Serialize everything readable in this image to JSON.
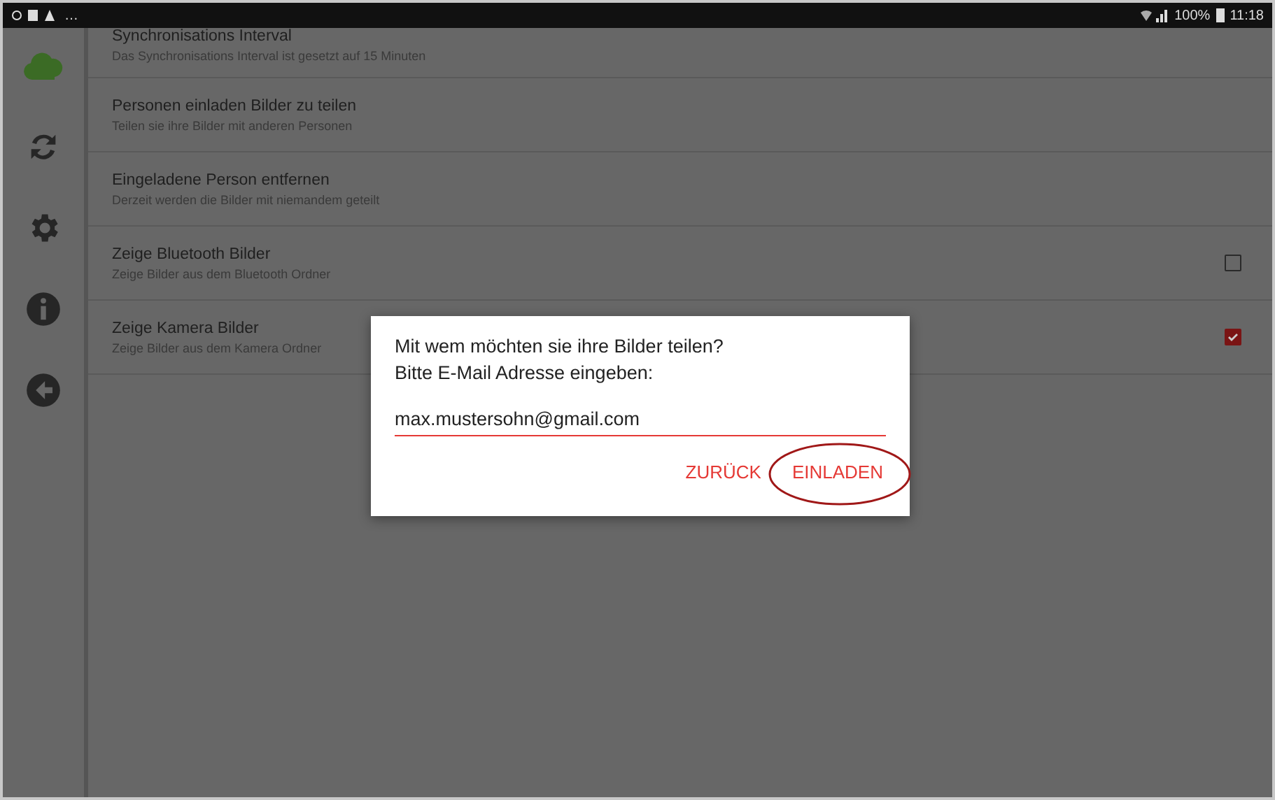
{
  "status_bar": {
    "left_text": "…",
    "battery": "100%",
    "time": "11:18"
  },
  "sidebar": {
    "items": [
      {
        "kind": "cloud",
        "selected": true
      },
      {
        "kind": "sync",
        "selected": false
      },
      {
        "kind": "settings",
        "selected": false
      },
      {
        "kind": "info",
        "selected": false
      },
      {
        "kind": "back",
        "selected": false
      }
    ]
  },
  "settings": [
    {
      "kind": "plain",
      "title": "Synchronisations Interval",
      "subtitle": "Das Synchronisations Interval ist gesetzt auf 15 Minuten"
    },
    {
      "kind": "plain",
      "title": "Personen einladen Bilder zu teilen",
      "subtitle": "Teilen sie ihre Bilder mit anderen Personen"
    },
    {
      "kind": "plain",
      "title": "Eingeladene Person entfernen",
      "subtitle": "Derzeit werden die Bilder mit niemandem geteilt"
    },
    {
      "kind": "checkbox",
      "title": "Zeige Bluetooth Bilder",
      "subtitle": "Zeige Bilder aus dem Bluetooth Ordner",
      "checked": false
    },
    {
      "kind": "checkbox",
      "title": "Zeige Kamera Bilder",
      "subtitle": "Zeige Bilder aus dem Kamera Ordner",
      "checked": true
    }
  ],
  "dialog": {
    "title": "Mit wem möchten sie ihre Bilder teilen?",
    "message": "Bitte E-Mail Adresse eingeben:",
    "email_value": "max.mustersohn@gmail.com",
    "buttons": [
      {
        "label": "ZURÜCK",
        "highlighted": false
      },
      {
        "label": "EINLADEN",
        "highlighted": true
      }
    ]
  }
}
